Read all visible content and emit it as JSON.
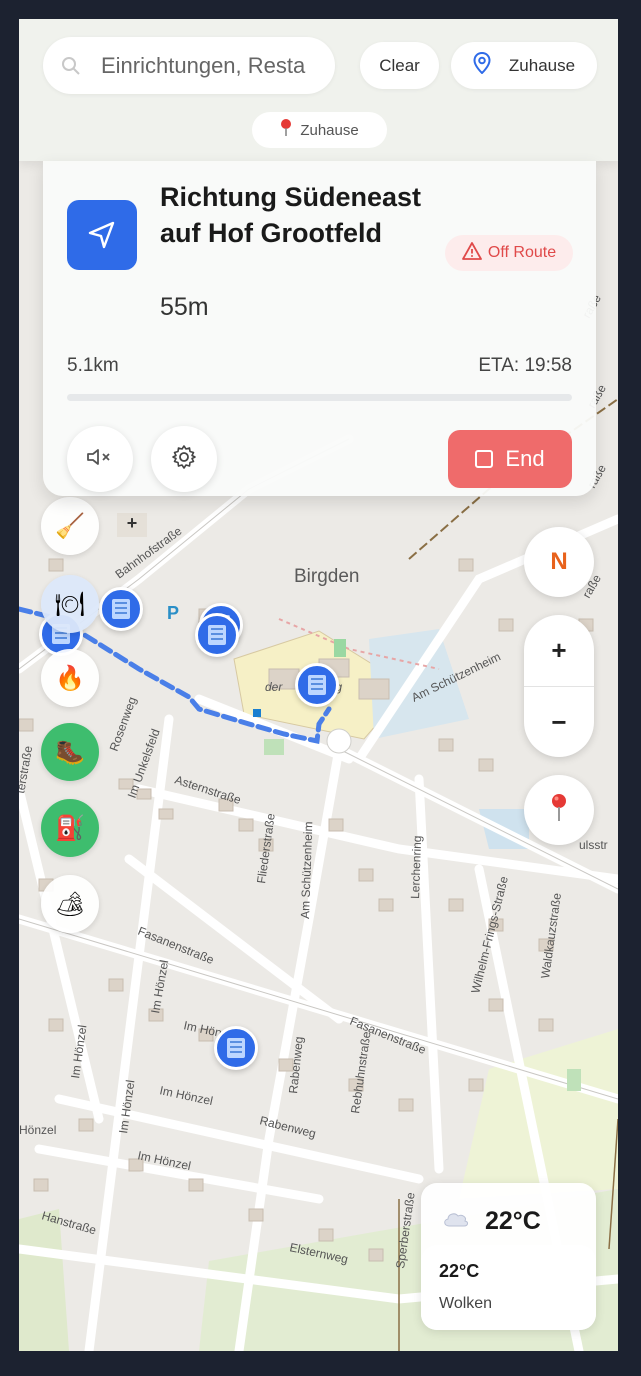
{
  "search": {
    "placeholder": "Einrichtungen, Resta"
  },
  "topbar": {
    "clear_label": "Clear",
    "home_label": "Zuhause",
    "chip_label": "Zuhause"
  },
  "navigation": {
    "instruction": "Richtung Südeneast auf Hof Grootfeld",
    "step_distance": "55m",
    "status": "Off Route",
    "total_distance": "5.1km",
    "eta": "ETA: 19:58",
    "end_label": "End",
    "progress": 0.0
  },
  "map": {
    "place": "Birgden",
    "streets": [
      "Bahnhofstraße",
      "Rosenweg",
      "Im Unkelsfeld",
      "Asternstraße",
      "Fliederstraße",
      "Am Schützenheim",
      "Lerchenring",
      "Wilhelm-Frings-Straße",
      "Waldkauzstraße",
      "Fasanenstraße",
      "Im Hönzel",
      "Rabenweg",
      "Rebhuhnstraße",
      "Hanstraße",
      "Elsternweg",
      "Sperberstraße"
    ]
  },
  "controls": {
    "compass": "N",
    "zoom_in": "+",
    "zoom_out": "−"
  },
  "weather": {
    "temp": "22°C",
    "temp2": "22°C",
    "desc": "Wolken"
  },
  "colors": {
    "accent": "#2f6be8",
    "danger": "#ef6b6b",
    "compass": "#e8621c",
    "route": "#4a7fe8"
  }
}
